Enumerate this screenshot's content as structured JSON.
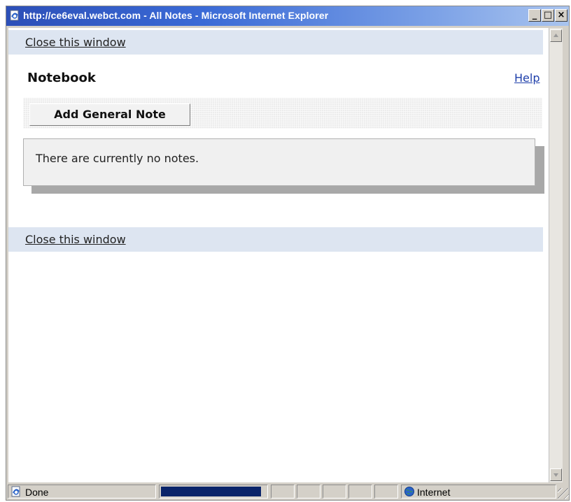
{
  "window": {
    "title": "http://ce6eval.webct.com - All Notes - Microsoft Internet Explorer",
    "controls": {
      "minimize": "_",
      "maximize": "□",
      "close": "×"
    }
  },
  "page": {
    "close_link_top": "Close this window",
    "notebook_title": "Notebook",
    "help_link": "Help",
    "add_button": "Add General Note",
    "notes_empty_message": "There are currently no notes.",
    "close_link_bottom": "Close this window"
  },
  "statusbar": {
    "status_text": "Done",
    "zone_text": "Internet",
    "progress_fraction": 0.95
  },
  "icons": {
    "title_icon": "ie-page-icon",
    "status_icon": "ie-page-icon",
    "zone_icon": "globe-icon"
  },
  "colors": {
    "title_bar_start": "#2c4fb8",
    "title_bar_end": "#a9c4ef",
    "close_bar_bg": "#dde5f1",
    "link_blue": "#1f3faa",
    "progress_fill": "#0a246a"
  }
}
